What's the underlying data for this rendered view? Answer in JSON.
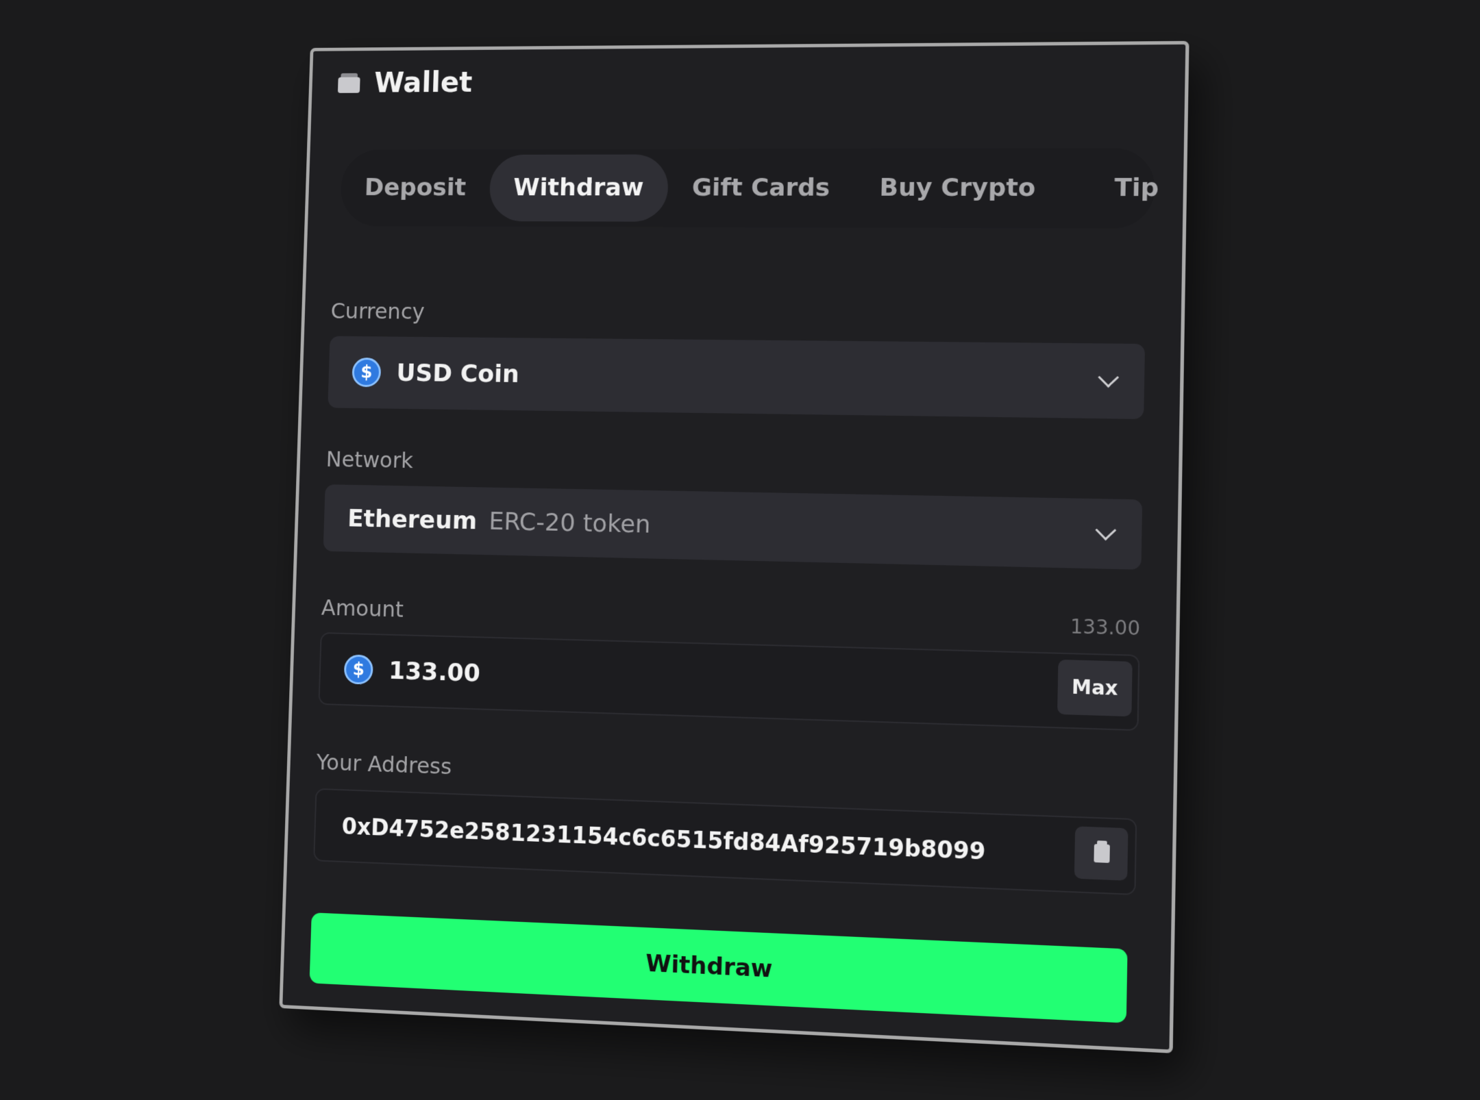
{
  "header": {
    "title": "Wallet"
  },
  "tabs": [
    {
      "label": "Deposit",
      "active": false
    },
    {
      "label": "Withdraw",
      "active": true
    },
    {
      "label": "Gift Cards",
      "active": false
    },
    {
      "label": "Buy Crypto",
      "active": false
    },
    {
      "label": "Tip",
      "active": false
    }
  ],
  "currency": {
    "label": "Currency",
    "value": "USD Coin",
    "icon": "usd-coin-icon",
    "coin_symbol": "$"
  },
  "network": {
    "label": "Network",
    "name": "Ethereum",
    "detail": "ERC-20 token"
  },
  "amount": {
    "label": "Amount",
    "balance": "133.00",
    "value": "133.00",
    "max_label": "Max",
    "coin_symbol": "$"
  },
  "address": {
    "label": "Your Address",
    "value": "0xD4752e2581231154c6c6515fd84Af925719b8099"
  },
  "submit": {
    "label": "Withdraw"
  },
  "colors": {
    "accent": "#22ff73",
    "panel": "#1f1f22",
    "background": "#1b1b1c"
  }
}
